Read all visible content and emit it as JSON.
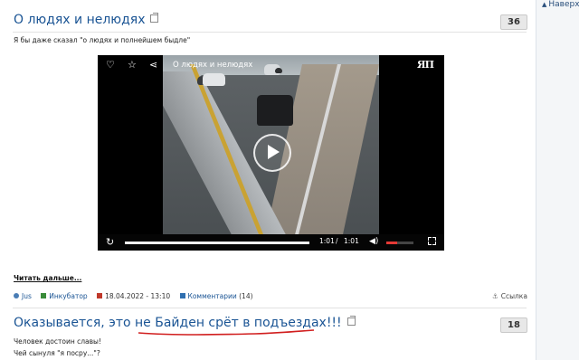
{
  "sidebar": {
    "up_link": "Наверх"
  },
  "post1": {
    "title": "О людях и нелюдях",
    "rating": "36",
    "text": "Я бы даже сказал \"о людях и полнейшем быдле\"",
    "video": {
      "title": "О людях и нелюдях",
      "logo": "ЯП",
      "current_time": "1:01",
      "separator": "/",
      "duration": "1:01",
      "progress": 1.0,
      "volume": 0.4
    },
    "read_more": "Читать дальше...",
    "meta": {
      "author": "Jus",
      "category": "Инкубатор",
      "date": "18.04.2022 - 13:10",
      "comments_label": "Комментарии",
      "comments_count": "(14)",
      "link_label": "Ссылка"
    }
  },
  "post2": {
    "title": "Оказывается, это не Байден срёт в подъездах!!!",
    "rating": "18",
    "line1": "Человек достоин славы!",
    "line2": "Чей сынуля \"я посру...\"?"
  },
  "colors": {
    "title": "#1a5494",
    "accent_red": "#e53935",
    "scribble": "#d11f1f"
  }
}
